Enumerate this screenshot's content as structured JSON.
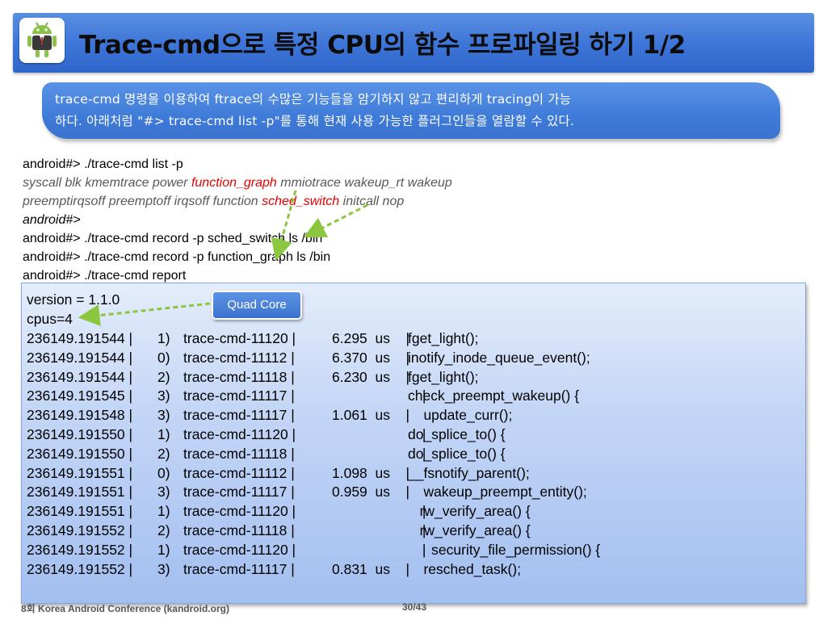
{
  "header": {
    "title": "Trace-cmd으로 특정 CPU의 함수 프로파일링 하기 1/2"
  },
  "description": {
    "line1": "trace-cmd 명령을 이용하여 ftrace의 수많은 기능들을 암기하지 않고 편리하게 tracing이 가능",
    "line2": "하다. 아래처럼 \"#> trace-cmd list -p\"를 통해 현재 사용 가능한 플러그인들을 열람할 수 있다."
  },
  "commands": {
    "list_cmd": "android#> ./trace-cmd list -p",
    "plugins_a1": "syscall blk kmemtrace power ",
    "plugins_a_red": "function_graph ",
    "plugins_a2": "mmiotrace wakeup_rt wakeup",
    "plugins_b1": "preemptirqsoff preemptoff irqsoff function ",
    "plugins_b_red": "sched_switch",
    "plugins_b2": " initcall nop",
    "prompt": "android#>",
    "record_sched": "android#> ./trace-cmd record -p sched_switch   ls /bin",
    "record_graph": "android#> ./trace-cmd record -p function_graph ls /bin",
    "report_cmd": "android#> ./trace-cmd report"
  },
  "report": {
    "version": "version = 1.1.0",
    "cpus": "cpus=4",
    "rows": [
      {
        "ts": "236149.191544 |",
        "cpu": "1)",
        "pid": "trace-cmd-11120 |",
        "dur": "6.295  us    |",
        "fn": "fget_light();"
      },
      {
        "ts": "236149.191544 |",
        "cpu": "0)",
        "pid": "trace-cmd-11112 |",
        "dur": "6.370  us    |",
        "fn": "inotify_inode_queue_event();"
      },
      {
        "ts": "236149.191544 |",
        "cpu": "2)",
        "pid": "trace-cmd-11118 |",
        "dur": "6.230  us    |",
        "fn": "fget_light();"
      },
      {
        "ts": "236149.191545 |",
        "cpu": "3)",
        "pid": "trace-cmd-11117 |",
        "dur": "                       |",
        "fn": "check_preempt_wakeup() {"
      },
      {
        "ts": "236149.191548 |",
        "cpu": "3)",
        "pid": "trace-cmd-11117 |",
        "dur": "1.061  us    |",
        "fn": "    update_curr();"
      },
      {
        "ts": "236149.191550 |",
        "cpu": "1)",
        "pid": "trace-cmd-11120 |",
        "dur": "                       |",
        "fn": "do_splice_to() {"
      },
      {
        "ts": "236149.191550 |",
        "cpu": "2)",
        "pid": "trace-cmd-11118 |",
        "dur": "                       |",
        "fn": "do_splice_to() {"
      },
      {
        "ts": "236149.191551 |",
        "cpu": "0)",
        "pid": "trace-cmd-11112 |",
        "dur": "1.098  us    |",
        "fn": "__fsnotify_parent();"
      },
      {
        "ts": "236149.191551 |",
        "cpu": "3)",
        "pid": "trace-cmd-11117 |",
        "dur": "0.959  us    |",
        "fn": "    wakeup_preempt_entity();"
      },
      {
        "ts": "236149.191551 |",
        "cpu": "1)",
        "pid": "trace-cmd-11120 |",
        "dur": "                       |",
        "fn": "   rw_verify_area() {"
      },
      {
        "ts": "236149.191552 |",
        "cpu": "2)",
        "pid": "trace-cmd-11118 |",
        "dur": "                       |",
        "fn": "   rw_verify_area() {"
      },
      {
        "ts": "236149.191552 |",
        "cpu": "1)",
        "pid": "trace-cmd-11120 |",
        "dur": "                       |",
        "fn": "      security_file_permission() {"
      },
      {
        "ts": "236149.191552 |",
        "cpu": "3)",
        "pid": "trace-cmd-11117 |",
        "dur": "0.831  us    |",
        "fn": "    resched_task();"
      }
    ]
  },
  "badge": {
    "label": "Quad Core"
  },
  "footer": {
    "conference": "8회 Korea Android Conference (kandroid.org)",
    "page": "30/43"
  },
  "icons": {
    "logo": "android-robot-icon"
  },
  "colors": {
    "header_blue": "#3c74d8",
    "highlight_red": "#e00000",
    "arrow_green": "#8cc63f"
  }
}
